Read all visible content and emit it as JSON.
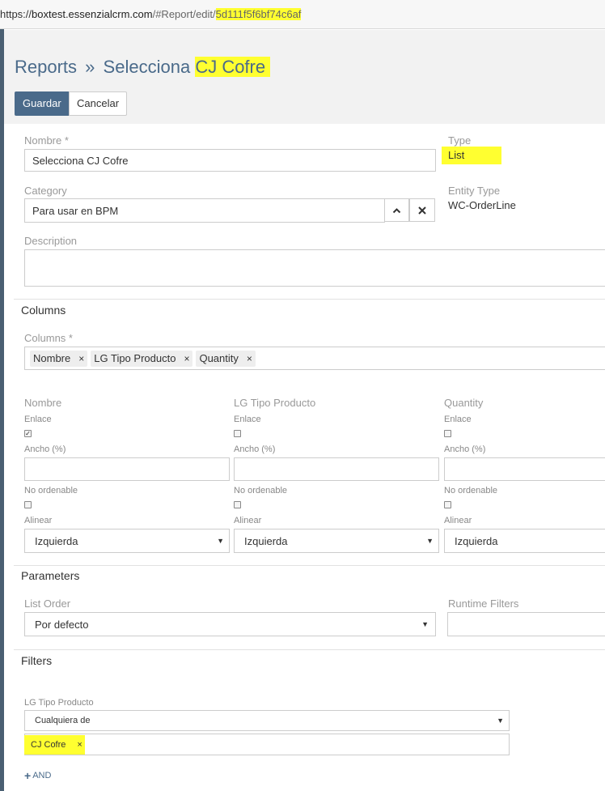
{
  "browser": {
    "url_scheme": "https://",
    "url_domain": "boxtest.essenzialcrm.com",
    "url_path": "/#Report/edit/",
    "url_id": "5d111f5f6bf74c6af"
  },
  "header": {
    "breadcrumb_root": "Reports",
    "breadcrumb_sep": "»",
    "title_prefix": "Selecciona",
    "title_highlight": "CJ Cofre"
  },
  "actions": {
    "save_label": "Guardar",
    "cancel_label": "Cancelar"
  },
  "fields": {
    "name_label": "Nombre *",
    "name_value": "Selecciona CJ Cofre",
    "type_label": "Type",
    "type_value": "List",
    "category_label": "Category",
    "category_value": "Para usar en BPM",
    "entity_type_label": "Entity Type",
    "entity_type_value": "WC-OrderLine",
    "description_label": "Description",
    "description_value": ""
  },
  "columns_section": {
    "title": "Columns",
    "columns_label": "Columns *",
    "tags": [
      {
        "label": "Nombre",
        "remove": "×"
      },
      {
        "label": "LG Tipo Producto",
        "remove": "×"
      },
      {
        "label": "Quantity",
        "remove": "×"
      }
    ],
    "columns": [
      {
        "name": "Nombre",
        "link_label": "Enlace",
        "link_checked": true,
        "width_label": "Ancho (%)",
        "width_value": "",
        "nosort_label": "No ordenable",
        "nosort_checked": false,
        "align_label": "Alinear",
        "align_value": "Izquierda"
      },
      {
        "name": "LG Tipo Producto",
        "link_label": "Enlace",
        "link_checked": false,
        "width_label": "Ancho (%)",
        "width_value": "",
        "nosort_label": "No ordenable",
        "nosort_checked": false,
        "align_label": "Alinear",
        "align_value": "Izquierda"
      },
      {
        "name": "Quantity",
        "link_label": "Enlace",
        "link_checked": false,
        "width_label": "Ancho (%)",
        "width_value": "",
        "nosort_label": "No ordenable",
        "nosort_checked": false,
        "align_label": "Alinear",
        "align_value": "Izquierda"
      }
    ]
  },
  "parameters_section": {
    "title": "Parameters",
    "list_order_label": "List Order",
    "list_order_value": "Por defecto",
    "runtime_filters_label": "Runtime Filters",
    "runtime_filters_value": ""
  },
  "filters_section": {
    "title": "Filters",
    "filter_label": "LG Tipo Producto",
    "operator_value": "Cualquiera de",
    "selected_tag": "CJ Cofre",
    "selected_tag_remove": "×",
    "add_and_label": "AND",
    "add_icon": "+"
  },
  "colors": {
    "accent": "#4a6a8a",
    "highlight": "#ffff30"
  }
}
